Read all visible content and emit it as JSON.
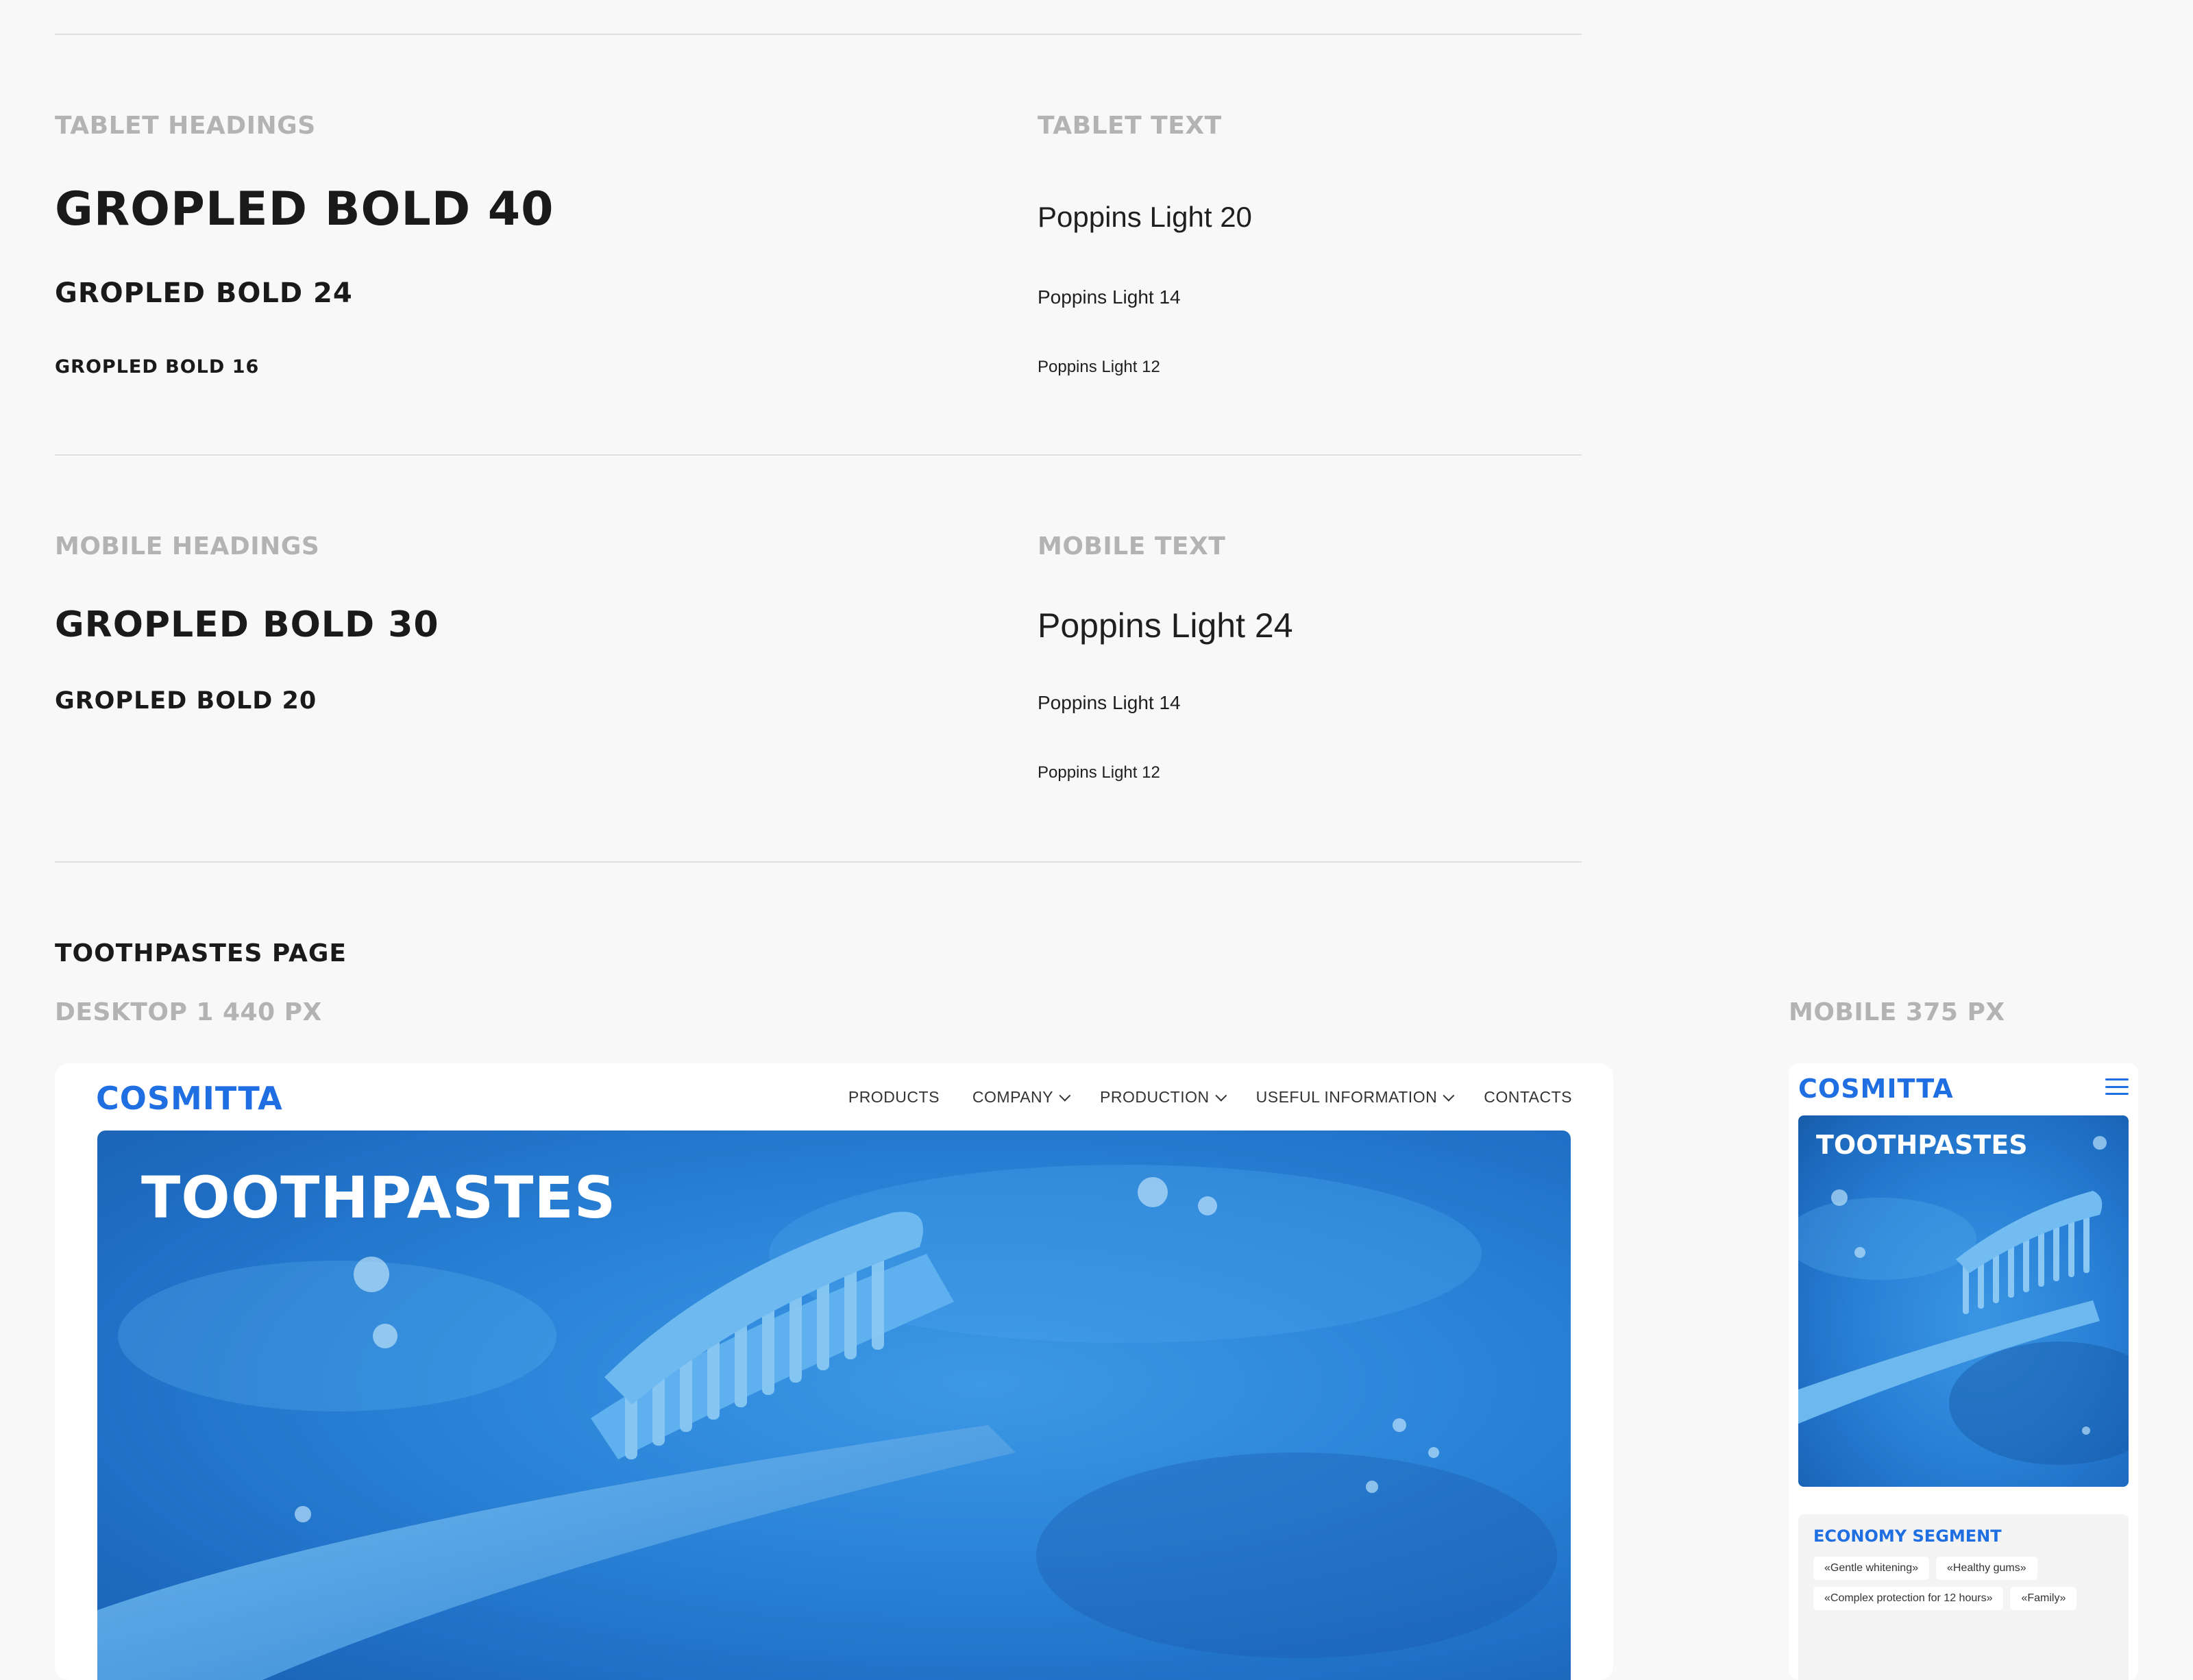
{
  "tablet": {
    "headings_label": "TABLET HEADINGS",
    "text_label": "TABLET TEXT",
    "headings": [
      "GROPLED BOLD 40",
      "GROPLED BOLD 24",
      "GROPLED BOLD 16"
    ],
    "texts": [
      "Poppins Light 20",
      "Poppins Light 14",
      "Poppins Light 12"
    ]
  },
  "mobile": {
    "headings_label": "MOBILE HEADINGS",
    "text_label": "MOBILE TEXT",
    "headings": [
      "GROPLED BOLD 30",
      "GROPLED BOLD 20"
    ],
    "texts": [
      "Poppins Light 24",
      "Poppins Light 14",
      "Poppins Light 12"
    ]
  },
  "page": {
    "title": "TOOTHPASTES PAGE",
    "desktop_label": "DESKTOP 1 440 PX",
    "mobile_label": "MOBILE 375 PX"
  },
  "desktop_mock": {
    "logo": "COSMITTA",
    "nav": [
      {
        "label": "PRODUCTS",
        "dropdown": false
      },
      {
        "label": "COMPANY",
        "dropdown": true
      },
      {
        "label": "PRODUCTION",
        "dropdown": true
      },
      {
        "label": "USEFUL INFORMATION",
        "dropdown": true
      },
      {
        "label": "CONTACTS",
        "dropdown": false
      }
    ],
    "hero_title": "TOOTHPASTES"
  },
  "mobile_mock": {
    "logo": "COSMITTA",
    "hero_title": "TOOTHPASTES",
    "segment_title": "ECONOMY SEGMENT",
    "chips": [
      "«Gentle whitening»",
      "«Healthy gums»",
      "«Complex protection for 12 hours»",
      "«Family»"
    ]
  },
  "colors": {
    "brand_blue": "#1f6fe3",
    "label_gray": "#b3b3b3",
    "background": "#f8f8f8"
  },
  "icons": [
    "chevron-down-icon",
    "hamburger-menu-icon"
  ]
}
